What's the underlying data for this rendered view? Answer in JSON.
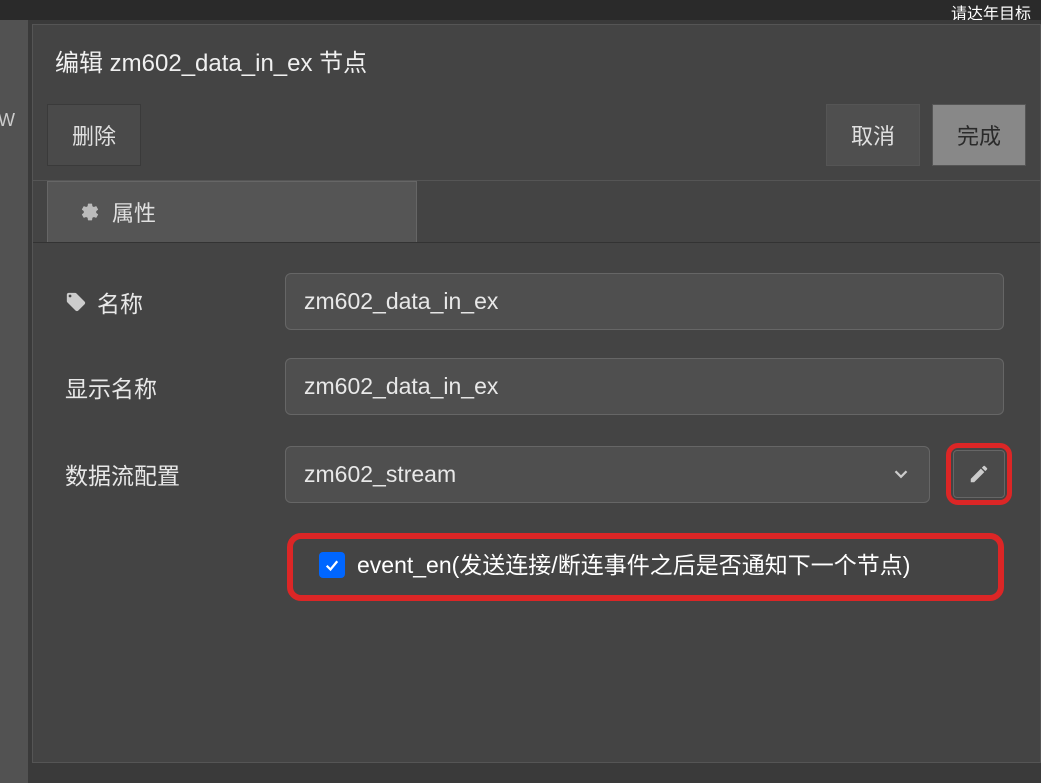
{
  "topbar": {
    "text": "请达年目标"
  },
  "leftStripe": {
    "text": "W"
  },
  "dialog": {
    "title": "编辑 zm602_data_in_ex 节点"
  },
  "buttons": {
    "delete": "删除",
    "cancel": "取消",
    "done": "完成"
  },
  "tabs": {
    "properties": "属性"
  },
  "form": {
    "nameLabel": "名称",
    "nameValue": "zm602_data_in_ex",
    "displayNameLabel": "显示名称",
    "displayNameValue": "zm602_data_in_ex",
    "streamConfigLabel": "数据流配置",
    "streamConfigValue": "zm602_stream",
    "eventEnLabel": "event_en(发送连接/断连事件之后是否通知下一个节点)"
  }
}
